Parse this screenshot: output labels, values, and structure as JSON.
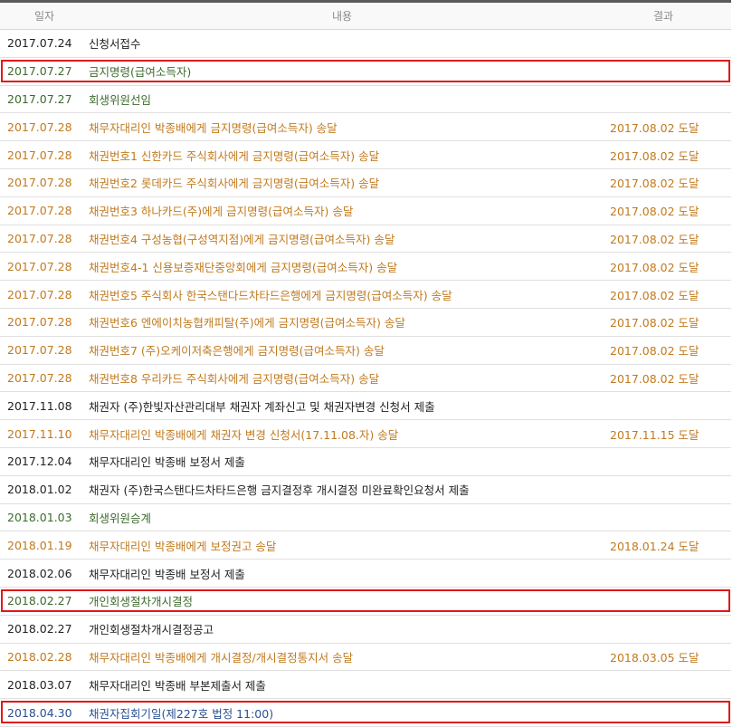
{
  "headers": {
    "date": "일자",
    "content": "내용",
    "result": "결과"
  },
  "rows": [
    {
      "date": "2017.07.24",
      "content": "신청서접수",
      "result": "",
      "color": "black"
    },
    {
      "date": "2017.07.27",
      "content": "금지명령(급여소득자)",
      "result": "",
      "color": "green",
      "highlight": true
    },
    {
      "date": "2017.07.27",
      "content": "회생위원선임",
      "result": "",
      "color": "green"
    },
    {
      "date": "2017.07.28",
      "content": "채무자대리인 박종배에게 금지명령(급여소득자) 송달",
      "result": "2017.08.02 도달",
      "color": "orange"
    },
    {
      "date": "2017.07.28",
      "content": "채권번호1 신한카드 주식회사에게 금지명령(급여소득자) 송달",
      "result": "2017.08.02 도달",
      "color": "orange"
    },
    {
      "date": "2017.07.28",
      "content": "채권번호2 롯데카드 주식회사에게 금지명령(급여소득자) 송달",
      "result": "2017.08.02 도달",
      "color": "orange"
    },
    {
      "date": "2017.07.28",
      "content": "채권번호3 하나카드(주)에게 금지명령(급여소득자) 송달",
      "result": "2017.08.02 도달",
      "color": "orange"
    },
    {
      "date": "2017.07.28",
      "content": "채권번호4 구성농협(구성역지점)에게 금지명령(급여소득자) 송달",
      "result": "2017.08.02 도달",
      "color": "orange"
    },
    {
      "date": "2017.07.28",
      "content": "채권번호4-1 신용보증재단중앙회에게 금지명령(급여소득자) 송달",
      "result": "2017.08.02 도달",
      "color": "orange"
    },
    {
      "date": "2017.07.28",
      "content": "채권번호5 주식회사 한국스탠다드차타드은행에게 금지명령(급여소득자) 송달",
      "result": "2017.08.02 도달",
      "color": "orange"
    },
    {
      "date": "2017.07.28",
      "content": "채권번호6 엔에이치농협캐피탈(주)에게 금지명령(급여소득자) 송달",
      "result": "2017.08.02 도달",
      "color": "orange"
    },
    {
      "date": "2017.07.28",
      "content": "채권번호7 (주)오케이저축은행에게 금지명령(급여소득자) 송달",
      "result": "2017.08.02 도달",
      "color": "orange"
    },
    {
      "date": "2017.07.28",
      "content": "채권번호8 우리카드 주식회사에게 금지명령(급여소득자) 송달",
      "result": "2017.08.02 도달",
      "color": "orange"
    },
    {
      "date": "2017.11.08",
      "content": "채권자 (주)한빛자산관리대부 채권자 계좌신고 및 채권자변경 신청서 제출",
      "result": "",
      "color": "black"
    },
    {
      "date": "2017.11.10",
      "content": "채무자대리인 박종배에게 채권자 변경 신청서(17.11.08.자) 송달",
      "result": "2017.11.15 도달",
      "color": "orange"
    },
    {
      "date": "2017.12.04",
      "content": "채무자대리인 박종배 보정서 제출",
      "result": "",
      "color": "black"
    },
    {
      "date": "2018.01.02",
      "content": "채권자 (주)한국스탠다드차타드은행 금지결정후 개시결정 미완료확인요청서 제출",
      "result": "",
      "color": "black"
    },
    {
      "date": "2018.01.03",
      "content": "회생위원승계",
      "result": "",
      "color": "green"
    },
    {
      "date": "2018.01.19",
      "content": "채무자대리인 박종배에게 보정권고 송달",
      "result": "2018.01.24 도달",
      "color": "orange"
    },
    {
      "date": "2018.02.06",
      "content": "채무자대리인 박종배 보정서 제출",
      "result": "",
      "color": "black"
    },
    {
      "date": "2018.02.27",
      "content": "개인회생절차개시결정",
      "result": "",
      "color": "green",
      "highlight": true
    },
    {
      "date": "2018.02.27",
      "content": "개인회생절차개시결정공고",
      "result": "",
      "color": "black"
    },
    {
      "date": "2018.02.28",
      "content": "채무자대리인 박종배에게 개시결정/개시결정통지서 송달",
      "result": "2018.03.05 도달",
      "color": "orange"
    },
    {
      "date": "2018.03.07",
      "content": "채무자대리인 박종배 부본제출서 제출",
      "result": "",
      "color": "black"
    },
    {
      "date": "2018.04.30",
      "content": "채권자집회기일(제227호 법정 11:00)",
      "result": "",
      "color": "blue",
      "highlight": true
    }
  ]
}
